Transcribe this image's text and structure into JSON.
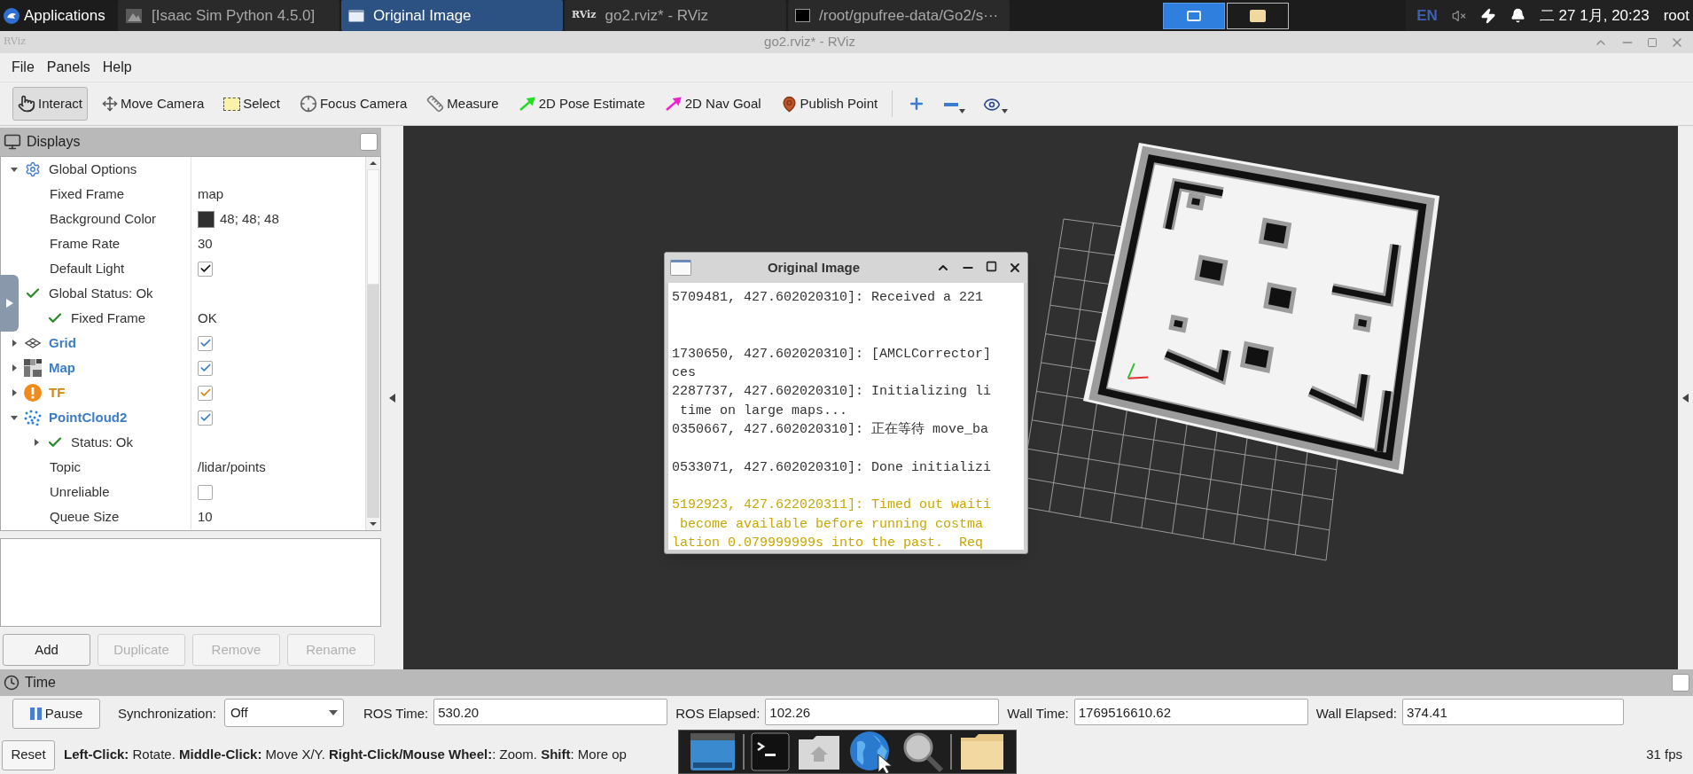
{
  "taskbar": {
    "menu": "Applications",
    "tasks": [
      {
        "label": "[Isaac Sim Python 4.5.0]",
        "selected": false,
        "kind": "app"
      },
      {
        "label": "Original Image",
        "selected": true,
        "kind": "window"
      },
      {
        "label": "go2.rviz* - RViz",
        "selected": false,
        "kind": "rviz",
        "logo": "RViz"
      },
      {
        "label": "/root/gpufree-data/Go2/s···",
        "selected": false,
        "kind": "terminal"
      }
    ],
    "workspaces": [
      {
        "selected": true,
        "kind": "window"
      },
      {
        "selected": false,
        "kind": "folder"
      }
    ],
    "tray": {
      "language": "EN",
      "clock": "二 27 1月, 20:23",
      "user": "root"
    }
  },
  "window": {
    "title": "go2.rviz* - RViz",
    "logo": "RViz"
  },
  "menu": [
    "File",
    "Panels",
    "Help"
  ],
  "toolbar": [
    {
      "label": "Interact",
      "kind": "interact",
      "selected": true
    },
    {
      "label": "Move Camera",
      "kind": "move",
      "selected": false
    },
    {
      "label": "Select",
      "kind": "select",
      "selected": false
    },
    {
      "label": "Focus Camera",
      "kind": "focus",
      "selected": false
    },
    {
      "label": "Measure",
      "kind": "measure",
      "selected": false
    },
    {
      "label": "2D Pose Estimate",
      "kind": "pose",
      "selected": false
    },
    {
      "label": "2D Nav Goal",
      "kind": "nav",
      "selected": false
    },
    {
      "label": "Publish Point",
      "kind": "publish",
      "selected": false
    }
  ],
  "view_buttons": [
    {
      "kind": "zoom-in"
    },
    {
      "kind": "zoom-out"
    },
    {
      "kind": "view"
    }
  ],
  "displays": {
    "title": "Displays",
    "tree": [
      {
        "kind": "options",
        "label": "Global Options",
        "expanded": true,
        "children": [
          {
            "kind": "property",
            "label": "Fixed Frame",
            "value": "map"
          },
          {
            "kind": "color",
            "label": "Background Color",
            "value": "48; 48; 48"
          },
          {
            "kind": "property",
            "label": "Frame Rate",
            "value": "30"
          },
          {
            "kind": "property",
            "label": "Default Light",
            "checked": true
          }
        ]
      },
      {
        "kind": "status",
        "label": "Global Status: Ok",
        "children": [
          {
            "kind": "status",
            "label": "Fixed Frame",
            "value": "OK"
          }
        ]
      },
      {
        "kind": "grid",
        "label": "Grid",
        "expanded": false,
        "checked": true,
        "color": "#3b7dc4"
      },
      {
        "kind": "map",
        "label": "Map",
        "expanded": false,
        "checked": true,
        "color": "#3b7dc4"
      },
      {
        "kind": "tf",
        "label": "TF",
        "expanded": false,
        "checked": true,
        "color": "#d4870e"
      },
      {
        "kind": "pointcloud",
        "label": "PointCloud2",
        "expanded": true,
        "checked": true,
        "color": "#3b7dc4",
        "children": [
          {
            "kind": "status",
            "label": "Status: Ok",
            "expanded": false
          },
          {
            "kind": "property",
            "label": "Topic",
            "value": "/lidar/points"
          },
          {
            "kind": "property",
            "label": "Unreliable",
            "checked": false
          },
          {
            "kind": "property",
            "label": "Queue Size",
            "value": "10"
          }
        ]
      }
    ],
    "buttons": [
      {
        "label": "Add",
        "disabled": false
      },
      {
        "label": "Duplicate",
        "disabled": true
      },
      {
        "label": "Remove",
        "disabled": true
      },
      {
        "label": "Rename",
        "disabled": true
      }
    ]
  },
  "log_window": {
    "title": "Original Image",
    "lines": [
      {
        "kind": "info",
        "text": "5709481, 427.602020310]: Received a 221"
      },
      {
        "kind": "blank"
      },
      {
        "kind": "blank"
      },
      {
        "kind": "info",
        "text": "1730650, 427.602020310]: [AMCLCorrector]"
      },
      {
        "kind": "info",
        "text": "ces"
      },
      {
        "kind": "info",
        "text": "2287737, 427.602020310]: Initializing li"
      },
      {
        "kind": "info",
        "text": " time on large maps..."
      },
      {
        "kind": "info",
        "text": "0350667, 427.602020310]: 正在等待 move_ba"
      },
      {
        "kind": "blank"
      },
      {
        "kind": "info",
        "text": "0533071, 427.602020310]: Done initializi"
      },
      {
        "kind": "blank"
      },
      {
        "kind": "warn",
        "text": "5192923, 427.622020311]: Timed out waiti"
      },
      {
        "kind": "warn",
        "text": " become available before running costma"
      },
      {
        "kind": "warn",
        "text": "lation 0.079999999s into the past.  Req"
      }
    ]
  },
  "time": {
    "title": "Time",
    "pause": "Pause",
    "sync_label": "Synchronization:",
    "sync_value": "Off",
    "fields": [
      {
        "label": "ROS Time:",
        "value": "530.20"
      },
      {
        "label": "ROS Elapsed:",
        "value": "102.26"
      },
      {
        "label": "Wall Time:",
        "value": "1769516610.62"
      },
      {
        "label": "Wall Elapsed:",
        "value": "374.41"
      }
    ]
  },
  "status": {
    "reset": "Reset",
    "hint": "**Left-Click:** Rotate. **Middle-Click:** Move X/Y. **Right-Click/Mouse Wheel:**: Zoom. **Shift**: More op",
    "fps": "31 fps"
  },
  "dock": [
    {
      "kind": "desktop"
    },
    {
      "kind": "separator"
    },
    {
      "kind": "terminal"
    },
    {
      "kind": "home"
    },
    {
      "kind": "browser"
    },
    {
      "kind": "search"
    },
    {
      "kind": "separator"
    },
    {
      "kind": "folder"
    }
  ]
}
